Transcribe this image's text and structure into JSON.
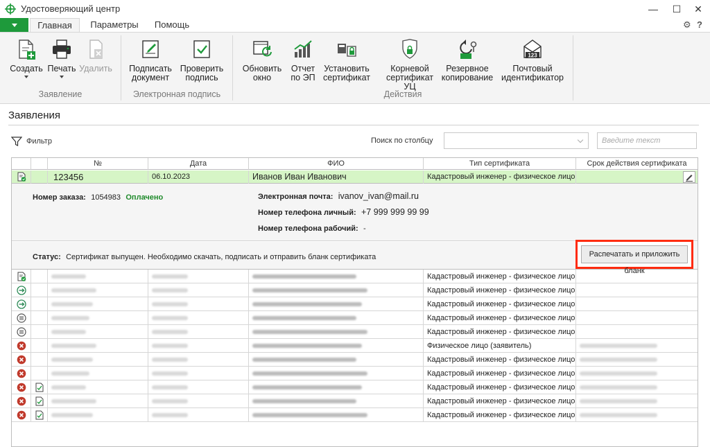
{
  "window": {
    "title": "Удостоверяющий центр",
    "minimize": "—",
    "maximize": "☐",
    "close": "✕"
  },
  "tabs": [
    "Главная",
    "Параметры",
    "Помощь"
  ],
  "topright": {
    "settings": "⚙",
    "help": "?"
  },
  "ribbon": {
    "groups": [
      {
        "label": "Заявление",
        "buttons": [
          {
            "line1": "Создать",
            "line2": "",
            "icon": "create-doc-icon",
            "dropdown": true,
            "disabled": false
          },
          {
            "line1": "Печать",
            "line2": "",
            "icon": "printer-icon",
            "dropdown": true,
            "disabled": false
          },
          {
            "line1": "Удалить",
            "line2": "",
            "icon": "delete-doc-icon",
            "dropdown": false,
            "disabled": true
          }
        ]
      },
      {
        "label": "Электронная подпись",
        "buttons": [
          {
            "line1": "Подписать",
            "line2": "документ",
            "icon": "sign-doc-icon"
          },
          {
            "line1": "Проверить",
            "line2": "подпись",
            "icon": "check-sign-icon"
          }
        ]
      },
      {
        "label": "Действия",
        "buttons": [
          {
            "line1": "Обновить",
            "line2": "окно",
            "icon": "refresh-icon"
          },
          {
            "line1": "Отчет",
            "line2": "по ЭП",
            "icon": "report-chart-icon"
          },
          {
            "line1": "Установить",
            "line2": "сертификат",
            "icon": "install-cert-icon"
          },
          {
            "line1": "Корневой",
            "line2": "сертификат УЦ",
            "icon": "root-cert-icon"
          },
          {
            "line1": "Резервное",
            "line2": "копирование",
            "icon": "backup-icon"
          },
          {
            "line1": "Почтовый",
            "line2": "идентификатор",
            "icon": "mail-id-icon"
          }
        ]
      }
    ],
    "mail_badge": "123"
  },
  "section": {
    "title": "Заявления"
  },
  "toolbar": {
    "filter": "Фильтр",
    "search_label": "Поиск по столбцу",
    "search_placeholder": "Введите текст"
  },
  "grid": {
    "headers": [
      "№",
      "Дата",
      "ФИО",
      "Тип сертификата",
      "Срок действия сертификата"
    ],
    "selected": {
      "number": "123456",
      "date": "06.10.2023",
      "name": "Иванов Иван Иванович",
      "type": "Кадастровый инженер - физическое лицо"
    },
    "detail": {
      "order_label": "Номер заказа:",
      "order_value": "1054983",
      "order_status": "Оплачено",
      "email_label": "Электронная почта:",
      "email_value": "ivanov_ivan@mail.ru",
      "phone_personal_label": "Номер телефона личный:",
      "phone_personal_value": "+7 999 999 99 99",
      "phone_work_label": "Номер телефона рабочий:",
      "phone_work_value": "-",
      "status_label": "Статус:",
      "status_value": "Сертификат выпущен. Необходимо скачать, подписать и отправить бланк сертификата",
      "print_button": "Распечатать и приложить бланк"
    },
    "rows": [
      {
        "status_icon": "doc-check-icon",
        "has_file": false,
        "type": "Кадастровый инженер - физическое лицо",
        "has_validity": false
      },
      {
        "status_icon": "arrow-circle-icon",
        "has_file": false,
        "type": "Кадастровый инженер - физическое лицо",
        "has_validity": false
      },
      {
        "status_icon": "arrow-circle-icon",
        "has_file": false,
        "type": "Кадастровый инженер - физическое лицо",
        "has_validity": false
      },
      {
        "status_icon": "list-circle-icon",
        "has_file": false,
        "type": "Кадастровый инженер - физическое лицо",
        "has_validity": false
      },
      {
        "status_icon": "list-circle-icon",
        "has_file": false,
        "type": "Кадастровый инженер - физическое лицо",
        "has_validity": false
      },
      {
        "status_icon": "cancel-circle-icon",
        "has_file": false,
        "type": "Физическое лицо (заявитель)",
        "has_validity": true
      },
      {
        "status_icon": "cancel-circle-icon",
        "has_file": false,
        "type": "Кадастровый инженер - физическое лицо",
        "has_validity": true
      },
      {
        "status_icon": "cancel-circle-icon",
        "has_file": false,
        "type": "Кадастровый инженер - физическое лицо",
        "has_validity": true
      },
      {
        "status_icon": "cancel-circle-icon",
        "has_file": true,
        "type": "Кадастровый инженер - физическое лицо",
        "has_validity": true
      },
      {
        "status_icon": "cancel-circle-icon",
        "has_file": true,
        "type": "Кадастровый инженер - физическое лицо",
        "has_validity": true
      },
      {
        "status_icon": "cancel-circle-icon",
        "has_file": true,
        "type": "Кадастровый инженер - физическое лицо",
        "has_validity": true
      }
    ]
  },
  "colors": {
    "accent": "#1e9a3b",
    "selected_row": "#d6f5c6",
    "highlight_frame": "#ff2b0f",
    "cancel_red": "#c0392b"
  }
}
